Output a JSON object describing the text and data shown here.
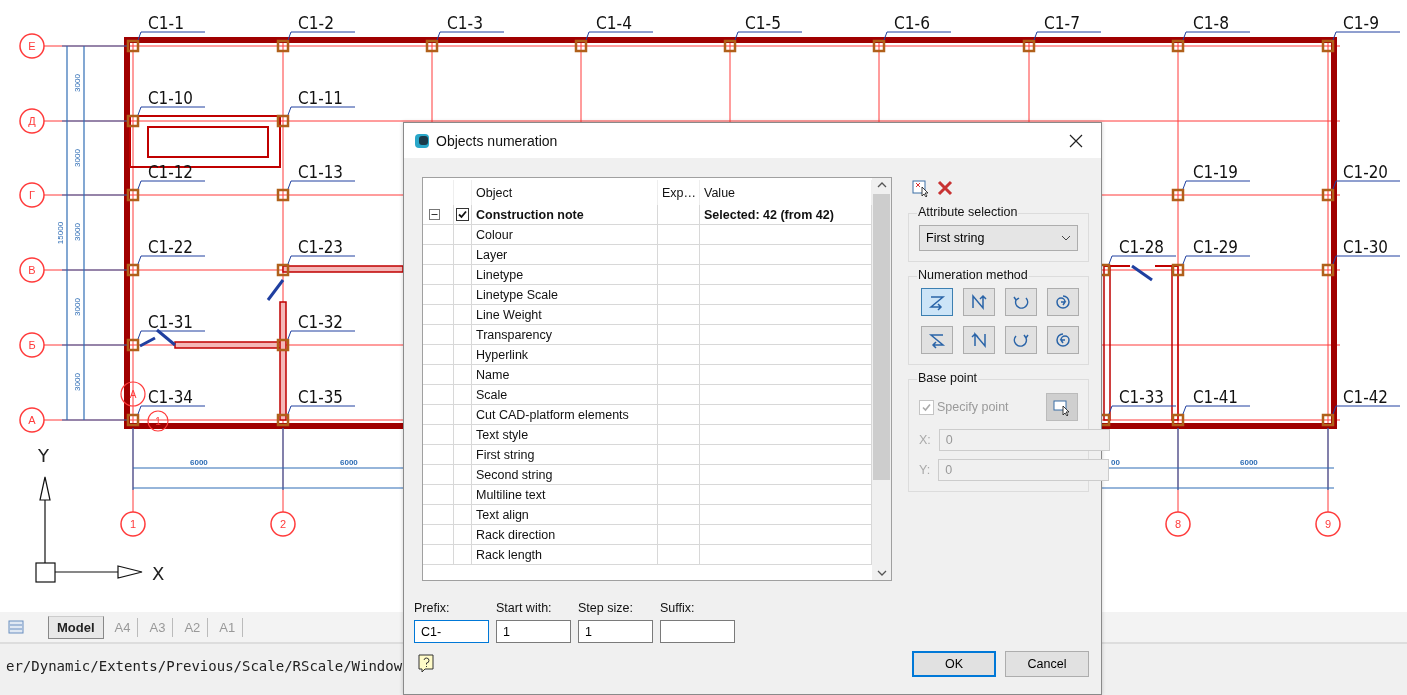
{
  "drawing": {
    "row_axes": [
      {
        "label": "Е"
      },
      {
        "label": "Д"
      },
      {
        "label": "Г"
      },
      {
        "label": "В"
      },
      {
        "label": "Б"
      },
      {
        "label": "А"
      }
    ],
    "column_axes": [
      {
        "label": "1"
      },
      {
        "label": "2"
      },
      {
        "label": "8"
      },
      {
        "label": "9"
      }
    ],
    "vertical_dimensions": [
      "3000",
      "3000",
      "3000",
      "3000",
      "3000"
    ],
    "overall_dimension": "15000",
    "horizontal_dimensions": [
      "6000",
      "6000",
      "00",
      "6000"
    ],
    "section_marks": [
      "А",
      "1"
    ],
    "marks": [
      "C1-1",
      "C1-2",
      "C1-3",
      "C1-4",
      "C1-5",
      "C1-6",
      "C1-7",
      "C1-8",
      "C1-9",
      "C1-10",
      "C1-11",
      "C1-12",
      "C1-13",
      "C1-19",
      "C1-20",
      "C1-22",
      "C1-23",
      "C1-28",
      "C1-29",
      "C1-30",
      "C1-31",
      "C1-32",
      "C1-34",
      "C1-35",
      "C1-33",
      "C1-41",
      "C1-42"
    ],
    "ucs": {
      "x_label": "X",
      "y_label": "Y"
    }
  },
  "layout_tabs": [
    {
      "label": "Model",
      "selected": true
    },
    {
      "label": "A4",
      "selected": false
    },
    {
      "label": "A3",
      "selected": false
    },
    {
      "label": "A2",
      "selected": false
    },
    {
      "label": "A1",
      "selected": false
    }
  ],
  "command_line": "er/Dynamic/Extents/Previous/Scale/RScale/Window",
  "dialog": {
    "title": "Objects numeration",
    "table": {
      "columns": [
        "Object",
        "Exp…",
        "Value"
      ],
      "group": {
        "object": "Construction note",
        "value": "Selected: 42 (from 42)",
        "expanded": true,
        "checked": true,
        "children": [
          {
            "object": "Colour"
          },
          {
            "object": "Layer"
          },
          {
            "object": "Linetype"
          },
          {
            "object": "Linetype Scale"
          },
          {
            "object": "Line Weight"
          },
          {
            "object": "Transparency"
          },
          {
            "object": "Hyperlink"
          },
          {
            "object": "Name"
          },
          {
            "object": "Scale"
          },
          {
            "object": "Cut CAD-platform elements"
          },
          {
            "object": "Text style"
          },
          {
            "object": "First string"
          },
          {
            "object": "Second string"
          },
          {
            "object": "Multiline text"
          },
          {
            "object": "Text align"
          },
          {
            "object": "Rack direction"
          },
          {
            "object": "Rack length"
          }
        ]
      }
    },
    "attribute_selection": {
      "title": "Attribute selection",
      "value": "First string"
    },
    "numeration_method": {
      "title": "Numeration method",
      "options": [
        {
          "selected": true
        },
        {
          "selected": false
        },
        {
          "selected": false
        },
        {
          "selected": false
        },
        {
          "selected": false
        },
        {
          "selected": false
        },
        {
          "selected": false
        },
        {
          "selected": false
        }
      ]
    },
    "base_point": {
      "title": "Base point",
      "specify_point": {
        "label": "Specify point",
        "checked": true
      },
      "disabled": true,
      "x": {
        "label": "X:",
        "value": "0"
      },
      "y": {
        "label": "Y:",
        "value": "0"
      }
    },
    "fields": [
      {
        "label": "Prefix:",
        "value": "C1-",
        "focused": true
      },
      {
        "label": "Start with:",
        "value": "1",
        "focused": false
      },
      {
        "label": "Step size:",
        "value": "1",
        "focused": false
      },
      {
        "label": "Suffix:",
        "focused": false
      }
    ],
    "buttons": [
      {
        "label": "OK",
        "default": true
      },
      {
        "label": "Cancel",
        "default": false
      }
    ]
  }
}
